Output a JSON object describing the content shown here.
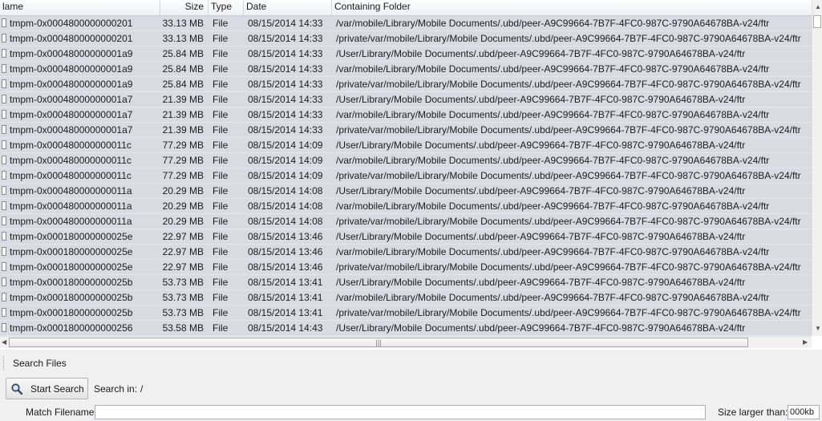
{
  "table": {
    "columns": {
      "name": "lame",
      "size": "Size",
      "type": "Type",
      "date": "Date",
      "folder": "Containing Folder"
    },
    "rows": [
      {
        "name": "tmpm-0x0004800000000201",
        "size": "33.13 MB",
        "type": "File",
        "date": "08/15/2014  14:33",
        "folder": "/var/mobile/Library/Mobile Documents/.ubd/peer-A9C99664-7B7F-4FC0-987C-9790A64678BA-v24/ftr"
      },
      {
        "name": "tmpm-0x0004800000000201",
        "size": "33.13 MB",
        "type": "File",
        "date": "08/15/2014  14:33",
        "folder": "/private/var/mobile/Library/Mobile Documents/.ubd/peer-A9C99664-7B7F-4FC0-987C-9790A64678BA-v24/ftr"
      },
      {
        "name": "tmpm-0x00048000000001a9",
        "size": "25.84 MB",
        "type": "File",
        "date": "08/15/2014  14:33",
        "folder": "/User/Library/Mobile Documents/.ubd/peer-A9C99664-7B7F-4FC0-987C-9790A64678BA-v24/ftr"
      },
      {
        "name": "tmpm-0x00048000000001a9",
        "size": "25.84 MB",
        "type": "File",
        "date": "08/15/2014  14:33",
        "folder": "/var/mobile/Library/Mobile Documents/.ubd/peer-A9C99664-7B7F-4FC0-987C-9790A64678BA-v24/ftr"
      },
      {
        "name": "tmpm-0x00048000000001a9",
        "size": "25.84 MB",
        "type": "File",
        "date": "08/15/2014  14:33",
        "folder": "/private/var/mobile/Library/Mobile Documents/.ubd/peer-A9C99664-7B7F-4FC0-987C-9790A64678BA-v24/ftr"
      },
      {
        "name": "tmpm-0x00048000000001a7",
        "size": "21.39 MB",
        "type": "File",
        "date": "08/15/2014  14:33",
        "folder": "/User/Library/Mobile Documents/.ubd/peer-A9C99664-7B7F-4FC0-987C-9790A64678BA-v24/ftr"
      },
      {
        "name": "tmpm-0x00048000000001a7",
        "size": "21.39 MB",
        "type": "File",
        "date": "08/15/2014  14:33",
        "folder": "/var/mobile/Library/Mobile Documents/.ubd/peer-A9C99664-7B7F-4FC0-987C-9790A64678BA-v24/ftr"
      },
      {
        "name": "tmpm-0x00048000000001a7",
        "size": "21.39 MB",
        "type": "File",
        "date": "08/15/2014  14:33",
        "folder": "/private/var/mobile/Library/Mobile Documents/.ubd/peer-A9C99664-7B7F-4FC0-987C-9790A64678BA-v24/ftr"
      },
      {
        "name": "tmpm-0x000480000000011c",
        "size": "77.29 MB",
        "type": "File",
        "date": "08/15/2014  14:09",
        "folder": "/User/Library/Mobile Documents/.ubd/peer-A9C99664-7B7F-4FC0-987C-9790A64678BA-v24/ftr"
      },
      {
        "name": "tmpm-0x000480000000011c",
        "size": "77.29 MB",
        "type": "File",
        "date": "08/15/2014  14:09",
        "folder": "/var/mobile/Library/Mobile Documents/.ubd/peer-A9C99664-7B7F-4FC0-987C-9790A64678BA-v24/ftr"
      },
      {
        "name": "tmpm-0x000480000000011c",
        "size": "77.29 MB",
        "type": "File",
        "date": "08/15/2014  14:09",
        "folder": "/private/var/mobile/Library/Mobile Documents/.ubd/peer-A9C99664-7B7F-4FC0-987C-9790A64678BA-v24/ftr"
      },
      {
        "name": "tmpm-0x000480000000011a",
        "size": "20.29 MB",
        "type": "File",
        "date": "08/15/2014  14:08",
        "folder": "/User/Library/Mobile Documents/.ubd/peer-A9C99664-7B7F-4FC0-987C-9790A64678BA-v24/ftr"
      },
      {
        "name": "tmpm-0x000480000000011a",
        "size": "20.29 MB",
        "type": "File",
        "date": "08/15/2014  14:08",
        "folder": "/var/mobile/Library/Mobile Documents/.ubd/peer-A9C99664-7B7F-4FC0-987C-9790A64678BA-v24/ftr"
      },
      {
        "name": "tmpm-0x000480000000011a",
        "size": "20.29 MB",
        "type": "File",
        "date": "08/15/2014  14:08",
        "folder": "/private/var/mobile/Library/Mobile Documents/.ubd/peer-A9C99664-7B7F-4FC0-987C-9790A64678BA-v24/ftr"
      },
      {
        "name": "tmpm-0x000180000000025e",
        "size": "22.97 MB",
        "type": "File",
        "date": "08/15/2014  13:46",
        "folder": "/User/Library/Mobile Documents/.ubd/peer-A9C99664-7B7F-4FC0-987C-9790A64678BA-v24/ftr"
      },
      {
        "name": "tmpm-0x000180000000025e",
        "size": "22.97 MB",
        "type": "File",
        "date": "08/15/2014  13:46",
        "folder": "/var/mobile/Library/Mobile Documents/.ubd/peer-A9C99664-7B7F-4FC0-987C-9790A64678BA-v24/ftr"
      },
      {
        "name": "tmpm-0x000180000000025e",
        "size": "22.97 MB",
        "type": "File",
        "date": "08/15/2014  13:46",
        "folder": "/private/var/mobile/Library/Mobile Documents/.ubd/peer-A9C99664-7B7F-4FC0-987C-9790A64678BA-v24/ftr"
      },
      {
        "name": "tmpm-0x000180000000025b",
        "size": "53.73 MB",
        "type": "File",
        "date": "08/15/2014  13:41",
        "folder": "/User/Library/Mobile Documents/.ubd/peer-A9C99664-7B7F-4FC0-987C-9790A64678BA-v24/ftr"
      },
      {
        "name": "tmpm-0x000180000000025b",
        "size": "53.73 MB",
        "type": "File",
        "date": "08/15/2014  13:41",
        "folder": "/var/mobile/Library/Mobile Documents/.ubd/peer-A9C99664-7B7F-4FC0-987C-9790A64678BA-v24/ftr"
      },
      {
        "name": "tmpm-0x000180000000025b",
        "size": "53.73 MB",
        "type": "File",
        "date": "08/15/2014  13:41",
        "folder": "/private/var/mobile/Library/Mobile Documents/.ubd/peer-A9C99664-7B7F-4FC0-987C-9790A64678BA-v24/ftr"
      },
      {
        "name": "tmpm-0x0001800000000256",
        "size": "53.58 MB",
        "type": "File",
        "date": "08/15/2014  14:43",
        "folder": "/User/Library/Mobile Documents/.ubd/peer-A9C99664-7B7F-4FC0-987C-9790A64678BA-v24/ftr"
      }
    ],
    "row_icon": "file-icon",
    "row_color": "#d8dbe2"
  },
  "panel": {
    "title": "Search Files",
    "start_search_label": "Start Search",
    "start_search_icon": "search-icon",
    "search_in_label": "Search in:",
    "search_in_value": "/",
    "match_filename_label": "Match Filename:",
    "match_filename_value": "",
    "size_larger_label": "Size larger than:",
    "size_larger_value": "000kb"
  }
}
